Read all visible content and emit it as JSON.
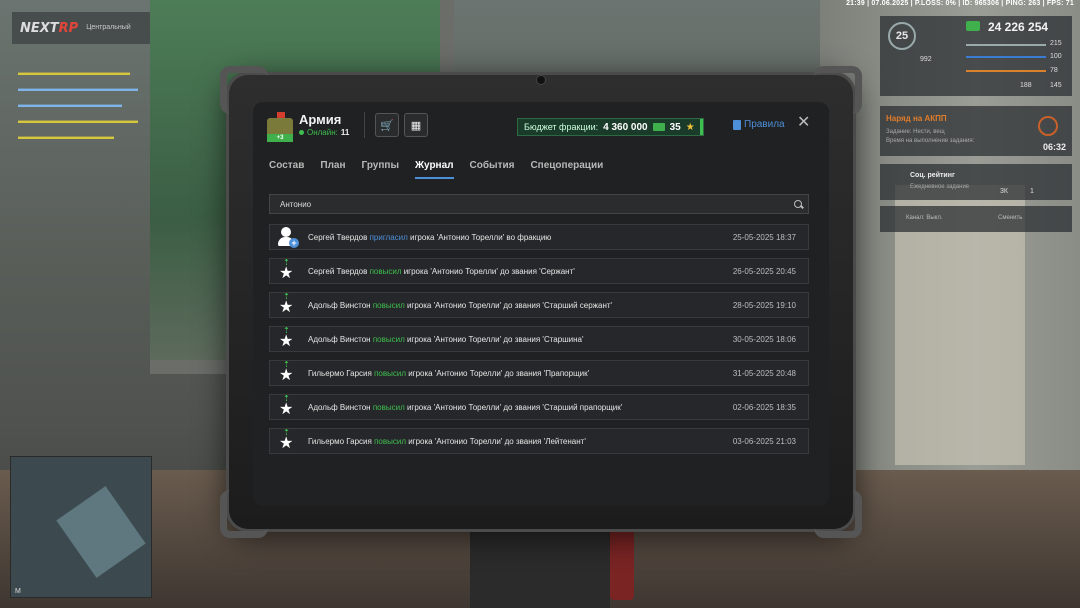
{
  "hud": {
    "status_line": "21:39 | 07.06.2025 | P.LOSS: 0% | ID: 965306 | PING: 263 | FPS: 71",
    "level": "25",
    "money": "24 226 254",
    "health": "215",
    "armor": "100",
    "hunger": "78",
    "stat_a": "188",
    "stat_b": "145",
    "stat_c": "992"
  },
  "logo": {
    "brand_prefix": "NEXT",
    "brand_suffix": "RP",
    "location": "Центральный"
  },
  "job": {
    "title": "Наряд на АКПП",
    "desc": "Задание: Нести, вещ\nВремя на выполнение задания:",
    "timer": "06:32"
  },
  "social": {
    "title": "Соц. рейтинг",
    "sub": "Ежедневное задание",
    "a": "3К",
    "b": "1"
  },
  "radio": {
    "label": "Канал: Выкл.",
    "switch": "Сменить"
  },
  "tablet": {
    "faction_name": "Армия",
    "emblem_tag": "+3",
    "online_label": "Онлайн:",
    "online_count": "11",
    "budget_label": "Бюджет фракции:",
    "budget_value": "4 360 000",
    "budget_stars": "35",
    "rules_label": "Правила",
    "tabs": [
      "Состав",
      "План",
      "Группы",
      "Журнал",
      "События",
      "Спецоперации"
    ],
    "active_tab": 3,
    "search_value": "Антонио",
    "log": [
      {
        "actor": "Сергей Твердов",
        "action": "пригласил",
        "kind": "invite",
        "rest": " игрока 'Антонио Торелли' во фракцию",
        "date": "25-05-2025 18:37"
      },
      {
        "actor": "Сергей Твердов",
        "action": "повысил",
        "kind": "promote",
        "rest": " игрока 'Антонио Торелли' до звания 'Сержант'",
        "date": "26-05-2025 20:45"
      },
      {
        "actor": "Адольф Винстон",
        "action": "повысил",
        "kind": "promote",
        "rest": " игрока 'Антонио Торелли' до звания 'Старший сержант'",
        "date": "28-05-2025 19:10"
      },
      {
        "actor": "Адольф Винстон",
        "action": "повысил",
        "kind": "promote",
        "rest": " игрока 'Антонио Торелли' до звания 'Старшина'",
        "date": "30-05-2025 18:06"
      },
      {
        "actor": "Гильермо Гарсия",
        "action": "повысил",
        "kind": "promote",
        "rest": " игрока 'Антонио Торелли' до звания 'Прапорщик'",
        "date": "31-05-2025 20:48"
      },
      {
        "actor": "Адольф Винстон",
        "action": "повысил",
        "kind": "promote",
        "rest": " игрока 'Антонио Торелли' до звания 'Старший прапорщик'",
        "date": "02-06-2025 18:35"
      },
      {
        "actor": "Гильермо Гарсия",
        "action": "повысил",
        "kind": "promote",
        "rest": " игрока 'Антонио Торелли' до звания 'Лейтенант'",
        "date": "03-06-2025 21:03"
      }
    ]
  },
  "minimap": {
    "label": "M"
  },
  "colors": {
    "accent_blue": "#4d8fd8",
    "accent_green": "#3fbf4f",
    "star_gold": "#f0c23a"
  },
  "icons": [
    "shopping-cart-icon",
    "calculator-icon",
    "book-icon",
    "close-icon",
    "search-icon",
    "user-plus-icon",
    "promote-star-icon",
    "cash-icon",
    "star-icon"
  ]
}
